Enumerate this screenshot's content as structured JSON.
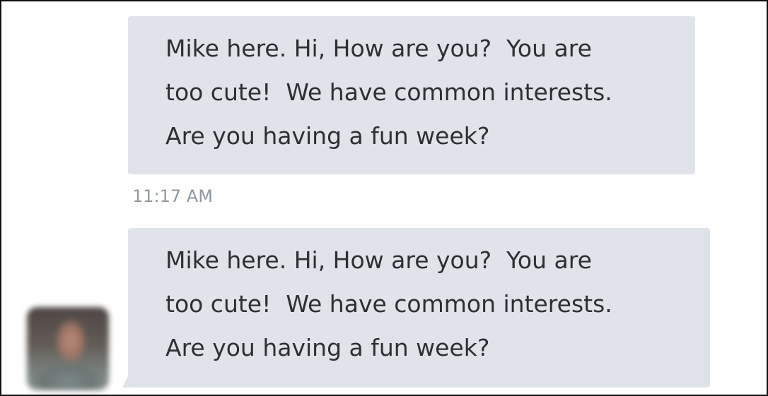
{
  "messages": [
    {
      "lines": [
        "Mike here. Hi, How are you?  You are",
        "too cute!  We have common interests.",
        "Are you having a fun week?"
      ],
      "timestamp": "11:17 AM"
    },
    {
      "lines": [
        "Mike here. Hi, How are you?  You are",
        "too cute!  We have common interests.",
        "Are you having a fun week?"
      ]
    }
  ],
  "colors": {
    "bubble_background": "#e1e3ea",
    "message_text": "#2d3033",
    "timestamp_text": "#8f97a3",
    "frame_border": "#111111"
  },
  "icons": {
    "sender_avatar": "blurred-profile-photo"
  }
}
